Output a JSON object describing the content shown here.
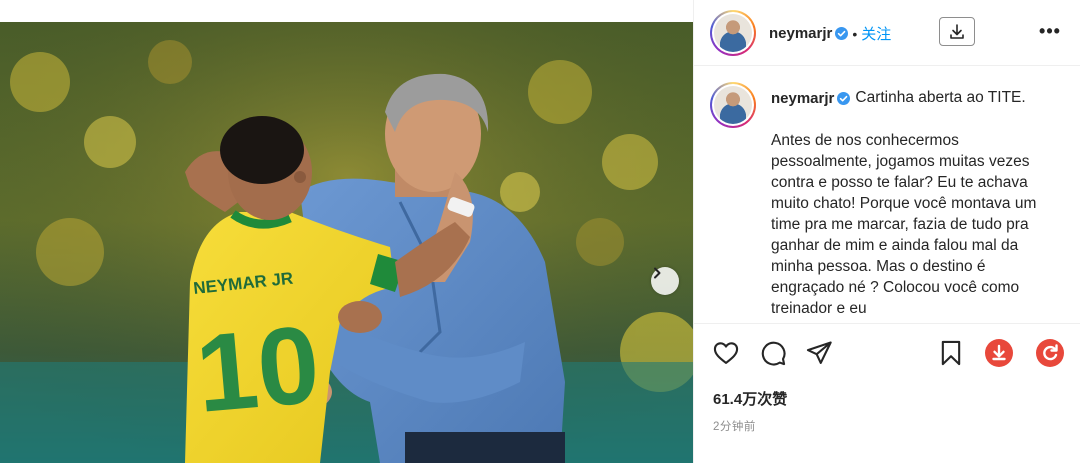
{
  "post": {
    "image_alt": "Two men embracing on a football pitch"
  },
  "header": {
    "username": "neymarjr",
    "separator": "•",
    "follow_label": "关注",
    "download_icon": "download-icon",
    "more_label": "•••"
  },
  "caption": {
    "username": "neymarjr",
    "title": "Cartinha aberta ao TITE.",
    "body": "Antes de nos conhecermos pessoalmente, jogamos muitas vezes contra e posso te falar? Eu te achava muito chato! Porque você montava um time pra me marcar, fazia de tudo pra ganhar de mim e ainda falou mal da minha pessoa. Mas o destino é engraçado né ? Colocou você como treinador e eu"
  },
  "actions": {
    "icons": [
      "heart-icon",
      "comment-icon",
      "share-icon",
      "bookmark-icon",
      "download-extension-icon",
      "refresh-extension-icon"
    ]
  },
  "likes": "61.4万次赞",
  "timestamp": "2分钟前",
  "colors": {
    "accent": "#0095f6",
    "verified": "#3897f0",
    "extension_red": "#e8483b"
  }
}
